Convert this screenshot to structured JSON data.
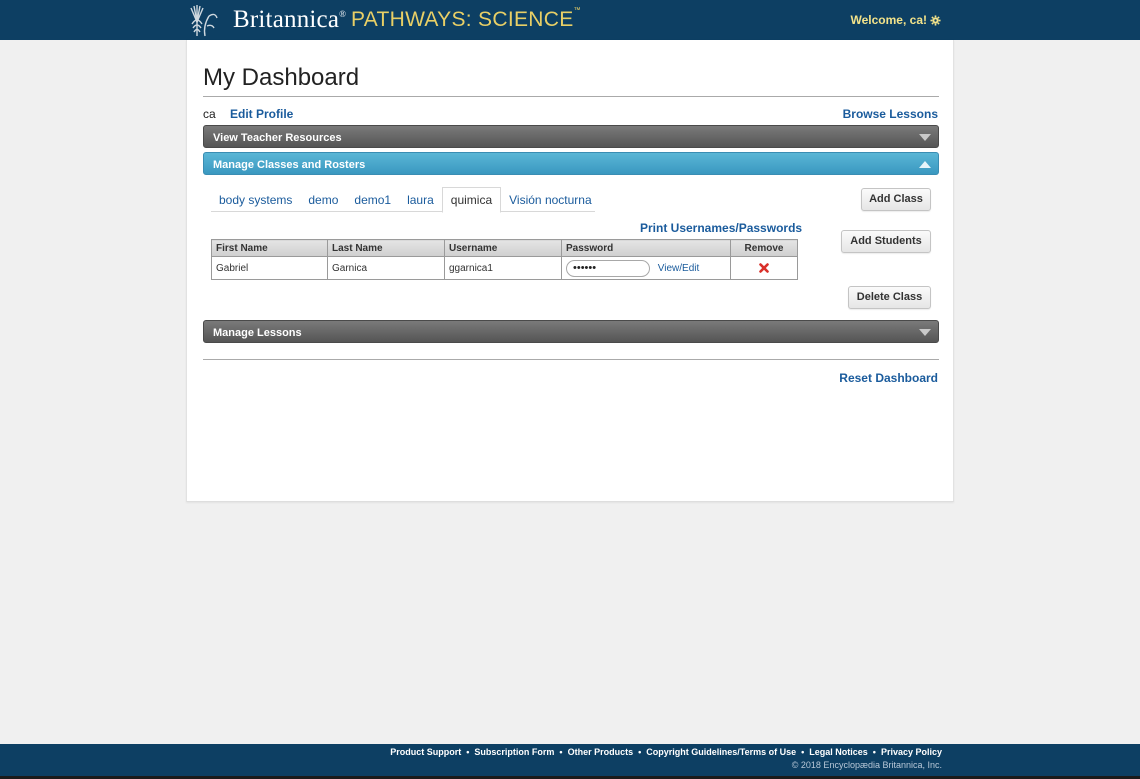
{
  "header": {
    "brand": "Britannica",
    "brand_mark": "®",
    "product": "PATHWAYS: SCIENCE",
    "product_mark": "™",
    "welcome": "Welcome, ca!"
  },
  "dashboard": {
    "title": "My Dashboard",
    "username": "ca",
    "edit_profile": "Edit Profile",
    "browse_lessons": "Browse Lessons",
    "reset_dashboard": "Reset Dashboard"
  },
  "sections": {
    "teacher_resources": "View Teacher Resources",
    "manage_classes": "Manage Classes and Rosters",
    "manage_lessons": "Manage Lessons"
  },
  "classes": {
    "tabs": [
      {
        "label": "body systems"
      },
      {
        "label": "demo"
      },
      {
        "label": "demo1"
      },
      {
        "label": "laura"
      },
      {
        "label": "quimica",
        "active": true
      },
      {
        "label": "Visión nocturna"
      }
    ],
    "add_class": "Add Class",
    "add_students": "Add Students",
    "delete_class": "Delete Class",
    "print_link": "Print Usernames/Passwords"
  },
  "roster": {
    "headers": [
      "First Name",
      "Last Name",
      "Username",
      "Password",
      "Remove"
    ],
    "rows": [
      {
        "first_name": "Gabriel",
        "last_name": "Garnica",
        "username": "ggarnica1",
        "password_mask": "••••••",
        "view_edit": "View/Edit"
      }
    ]
  },
  "footer": {
    "links": [
      "Product Support",
      "Subscription Form",
      "Other Products",
      "Copyright Guidelines/Terms of Use",
      "Legal Notices",
      "Privacy Policy"
    ],
    "separator": "•",
    "copyright": "© 2018 Encyclopædia Britannica, Inc."
  },
  "colors": {
    "header_bg": "#0d3f63",
    "product_gold": "#e8cf66",
    "link_blue": "#1a5b9c",
    "accordion_active": "#4aa8cc",
    "accordion_gray": "#666666",
    "remove_red": "#d9302a"
  },
  "icons": {
    "logo": "thistle-logo-icon",
    "settings": "gear-icon",
    "collapse": "triangle-down-icon",
    "expand": "triangle-up-icon",
    "remove": "red-x-icon"
  }
}
